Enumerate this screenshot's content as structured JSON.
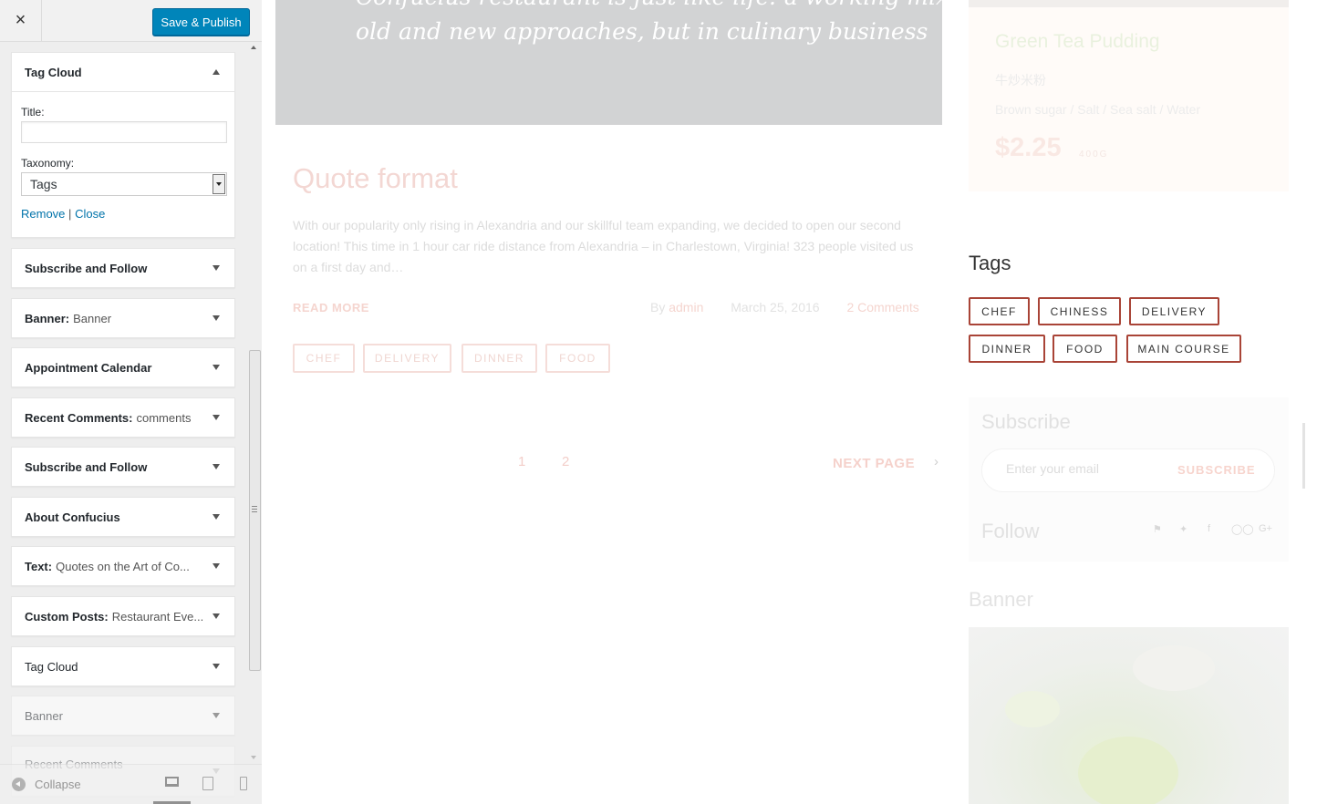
{
  "customizer": {
    "close_icon": "×",
    "publish_label": "Save & Publish",
    "open_widget": {
      "title": "Tag Cloud",
      "title_field_label": "Title:",
      "title_value": "",
      "taxonomy_label": "Taxonomy:",
      "taxonomy_value": "Tags",
      "remove_label": "Remove",
      "separator": "|",
      "close_label": "Close"
    },
    "widgets": [
      {
        "title": "Subscribe and Follow",
        "subtitle": ""
      },
      {
        "title": "Banner",
        "subtitle": "Banner"
      },
      {
        "title": "Appointment Calendar",
        "subtitle": ""
      },
      {
        "title": "Recent Comments",
        "subtitle": "comments"
      },
      {
        "title": "Subscribe and Follow",
        "subtitle": ""
      },
      {
        "title": "About Confucius",
        "subtitle": ""
      },
      {
        "title": "Text",
        "subtitle": "Quotes on the Art of Co..."
      },
      {
        "title": "Custom Posts",
        "subtitle": "Restaurant Eve..."
      },
      {
        "title": "Tag Cloud",
        "subtitle": ""
      },
      {
        "title": "Banner",
        "subtitle": ""
      },
      {
        "title": "Recent Comments",
        "subtitle": ""
      }
    ],
    "footer": {
      "collapse_label": "Collapse",
      "devices": [
        "desktop-icon",
        "tablet-icon",
        "mobile-icon"
      ]
    }
  },
  "preview": {
    "quote_line1": "Confucius restaurant is just like life: a working mix of",
    "quote_line2": "old and new approaches, but in culinary business",
    "post": {
      "title": "Quote format",
      "excerpt": "With our popularity only rising in Alexandria and our skillful team expanding, we decided to open our second location! This time in 1 hour car ride distance from Alexandria – in Charlestown, Virginia! 323 people visited us on a first day and…",
      "read_more": "READ MORE",
      "by_label": "By",
      "author": "admin",
      "date": "March 25, 2016",
      "comments": "2 Comments",
      "tags": [
        "CHEF",
        "DELIVERY",
        "DINNER",
        "FOOD"
      ]
    },
    "pagination": {
      "pages": [
        "1",
        "2"
      ],
      "next_label": "NEXT PAGE",
      "next_icon": "›"
    },
    "menu_item": {
      "name": "Green Tea Pudding",
      "chinese": "牛炒米粉",
      "ingredients": "Brown sugar / Salt / Sea salt / Water",
      "price": "$2.25",
      "weight": "400G"
    },
    "tags_widget": {
      "title": "Tags",
      "tags": [
        "CHEF",
        "CHINESS",
        "DELIVERY",
        "DINNER",
        "FOOD",
        "MAIN COURSE"
      ]
    },
    "subscribe_widget": {
      "title": "Subscribe",
      "email_placeholder": "Enter your email",
      "button_label": "SUBSCRIBE",
      "follow_title": "Follow",
      "social_icons": [
        "foursquare-icon",
        "twitter-icon",
        "facebook-icon",
        "tripadvisor-icon",
        "google-plus-icon"
      ]
    },
    "banner_widget": {
      "title": "Banner"
    },
    "colors": {
      "primary_button": "#0085ba",
      "tag_border": "#a94437",
      "link": "#0073aa"
    }
  }
}
